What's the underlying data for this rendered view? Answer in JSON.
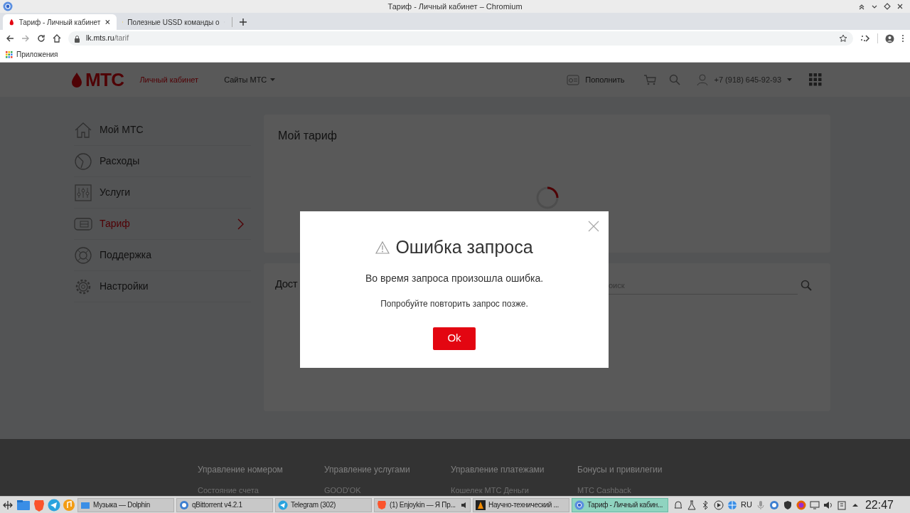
{
  "window": {
    "title": "Тариф - Личный кабинет – Chromium"
  },
  "tabs": [
    {
      "title": "Тариф - Личный кабинет",
      "selected": true
    },
    {
      "title": "Полезные USSD команды о",
      "selected": false
    }
  ],
  "address_bar": {
    "host": "lk.mts.ru",
    "path": "/tarif"
  },
  "bookmarks": [
    {
      "label": "Приложения"
    }
  ],
  "site_header": {
    "logo": "МТС",
    "cabinet": "Личный кабинет",
    "sites": "Сайты МТС",
    "top_up": "Пополнить",
    "phone": "+7 (918) 645-92-93"
  },
  "sidebar": {
    "items": [
      {
        "label": "Мой МТС",
        "selected": false
      },
      {
        "label": "Расходы",
        "selected": false
      },
      {
        "label": "Услуги",
        "selected": false
      },
      {
        "label": "Тариф",
        "selected": true
      },
      {
        "label": "Поддержка",
        "selected": false
      },
      {
        "label": "Настройки",
        "selected": false
      }
    ]
  },
  "tariff_card": {
    "title": "Мой тариф"
  },
  "options_card": {
    "title": "Дост",
    "search": {
      "placeholder": "оиск"
    }
  },
  "footer": {
    "columns": [
      {
        "heading": "Управление номером",
        "item": "Состояние счета"
      },
      {
        "heading": "Управление услугами",
        "item": "GOOD'OK"
      },
      {
        "heading": "Управление платежами",
        "item": "Кошелек МТС Деньги"
      },
      {
        "heading": "Бонусы и привилегии",
        "item": "MTC Cashback"
      }
    ]
  },
  "dialog": {
    "title": "Ошибка запроса",
    "message": "Во время запроса произошла ошибка.",
    "hint": "Попробуйте повторить запрос позже.",
    "button": "Ok"
  },
  "taskbar": {
    "windows": [
      {
        "title": "Музыка — Dolphin",
        "selected": false
      },
      {
        "title": "qBittorrent v4.2.1",
        "selected": false
      },
      {
        "title": "Telegram (302)",
        "selected": false
      },
      {
        "title": "(1) Enjoykin — Я Пр...",
        "selected": false
      },
      {
        "title": "Научно-технический ...",
        "selected": false
      },
      {
        "title": "Тариф - Личный кабин...",
        "selected": true
      }
    ],
    "language": "RU",
    "clock": "22:47"
  }
}
